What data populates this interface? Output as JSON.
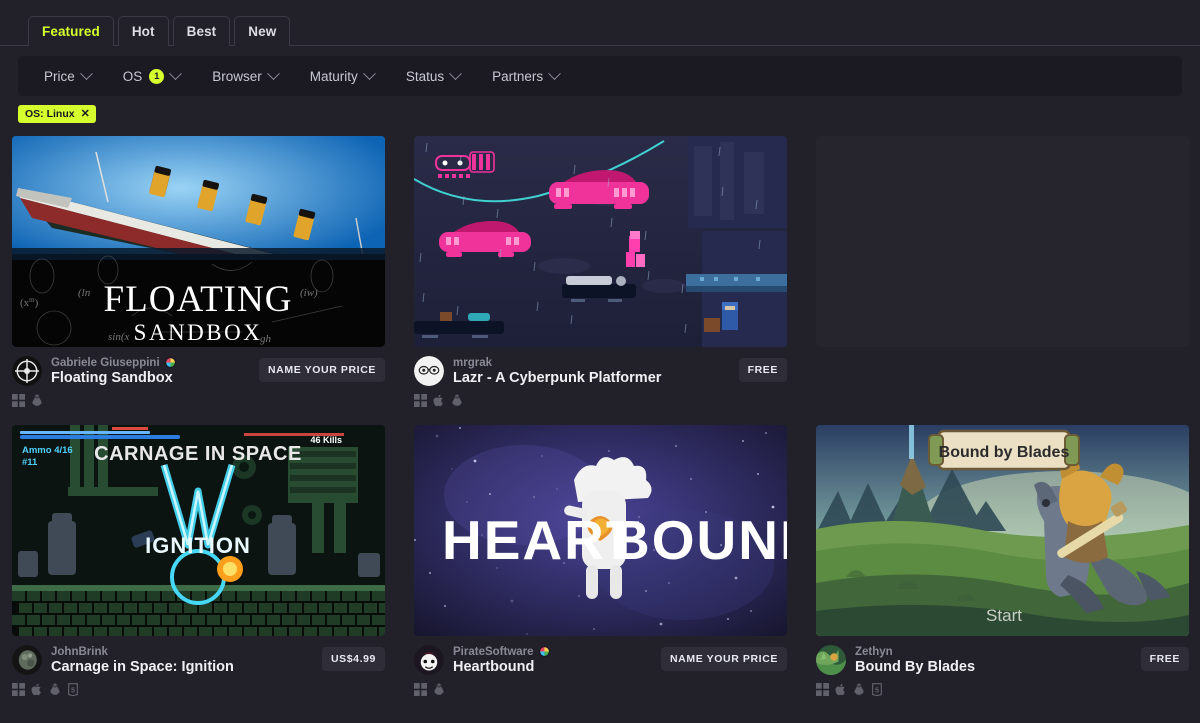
{
  "tabs": [
    {
      "label": "Featured",
      "active": true
    },
    {
      "label": "Hot",
      "active": false
    },
    {
      "label": "Best",
      "active": false
    },
    {
      "label": "New",
      "active": false
    }
  ],
  "filters": [
    {
      "label": "Price",
      "count": null
    },
    {
      "label": "OS",
      "count": "1"
    },
    {
      "label": "Browser",
      "count": null
    },
    {
      "label": "Maturity",
      "count": null
    },
    {
      "label": "Status",
      "count": null
    },
    {
      "label": "Partners",
      "count": null
    }
  ],
  "active_tags": [
    {
      "label": "OS: Linux",
      "remove": "✕"
    }
  ],
  "colors": {
    "accent": "#d6ff2e",
    "page_bg": "#222129",
    "filter_bg": "#1b1a22",
    "price_bg": "#2e2d38",
    "title": "#f0f0f4",
    "author": "#8a8a96"
  },
  "cards": [
    {
      "id": "floating-sandbox",
      "author": "Gabriele Giuseppini",
      "verified": true,
      "title": "Floating Sandbox",
      "price": "NAME YOUR PRICE",
      "platforms": [
        "windows",
        "linux"
      ],
      "thumb": "floating-sandbox",
      "thumb_text": {
        "line1": "FLOATING",
        "line2": "SANDBOX"
      }
    },
    {
      "id": "lazr",
      "author": "mrgrak",
      "verified": false,
      "title": "Lazr - A Cyberpunk Platformer",
      "price": "FREE",
      "platforms": [
        "windows",
        "apple",
        "linux"
      ],
      "thumb": "lazr",
      "thumb_text": null
    },
    {
      "id": "placeholder",
      "author": "",
      "verified": false,
      "title": "",
      "price": "",
      "platforms": [],
      "thumb": "empty",
      "thumb_text": null
    },
    {
      "id": "carnage-in-space",
      "author": "JohnBrink",
      "verified": false,
      "title": "Carnage in Space: Ignition",
      "price": "US$4.99",
      "platforms": [
        "windows",
        "apple",
        "linux",
        "html5"
      ],
      "thumb": "carnage",
      "thumb_text": {
        "line1": "CARNAGE IN SPACE",
        "line2": "IGNITION",
        "hud_ammo": "Ammo 4/16",
        "hud_clip": "#11",
        "hud_kills": "46 Kills"
      }
    },
    {
      "id": "heartbound",
      "author": "PirateSoftware",
      "verified": true,
      "title": "Heartbound",
      "price": "NAME YOUR PRICE",
      "platforms": [
        "windows",
        "linux"
      ],
      "thumb": "heartbound",
      "thumb_text": {
        "line1": "HEART",
        "line2": "BOUND"
      }
    },
    {
      "id": "bound-by-blades",
      "author": "Zethyn",
      "verified": false,
      "title": "Bound By Blades",
      "price": "FREE",
      "platforms": [
        "windows",
        "apple",
        "linux",
        "html5"
      ],
      "thumb": "bound-by-blades",
      "thumb_text": {
        "line1": "Bound by Blades",
        "line2": "Start"
      }
    }
  ]
}
